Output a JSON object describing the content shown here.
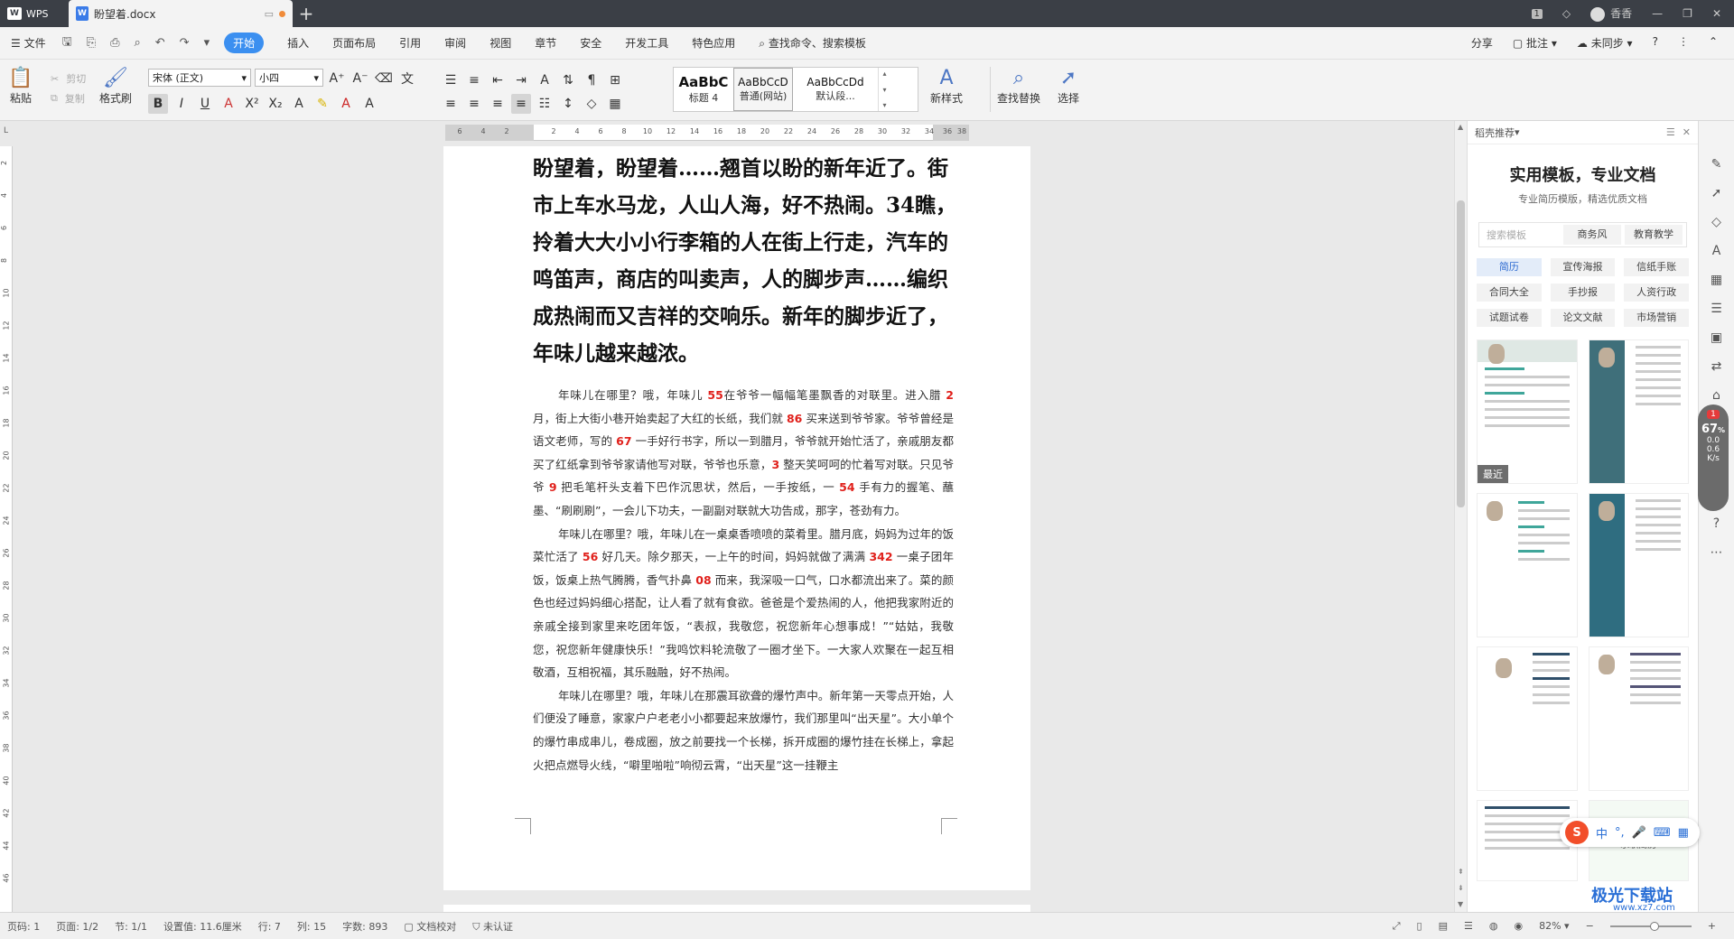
{
  "titlebar": {
    "app": "WPS",
    "doc_tab": "盼望着.docx",
    "user": "香香"
  },
  "menu": {
    "file": "文件",
    "items": [
      "开始",
      "插入",
      "页面布局",
      "引用",
      "审阅",
      "视图",
      "章节",
      "安全",
      "开发工具",
      "特色应用"
    ],
    "active": "开始",
    "search": "查找命令、搜索模板",
    "share": "分享",
    "comment": "批注",
    "sync": "未同步"
  },
  "ribbon": {
    "paste": "粘贴",
    "cut": "剪切",
    "copy": "复制",
    "format_painter": "格式刷",
    "font_name": "宋体 (正文)",
    "font_size": "小四",
    "styles": [
      {
        "preview": "AaBbC",
        "name": "标题 4"
      },
      {
        "preview": "AaBbCcD",
        "name": "普通(网站)"
      },
      {
        "preview": "AaBbCcDd",
        "name": "默认段..."
      }
    ],
    "new_style": "新样式",
    "find_replace": "查找替换",
    "select": "选择"
  },
  "ruler": {
    "h_ticks": [
      "6",
      "4",
      "2",
      "",
      "2",
      "4",
      "6",
      "8",
      "10",
      "12",
      "14",
      "16",
      "18",
      "20",
      "22",
      "24",
      "26",
      "28",
      "30",
      "32",
      "34",
      "36",
      "38",
      "40"
    ],
    "v_ticks": [
      "2",
      "4",
      "6",
      "8",
      "10",
      "12",
      "14",
      "16",
      "18",
      "20",
      "22",
      "24",
      "26",
      "28",
      "30",
      "32",
      "34",
      "36",
      "38",
      "40",
      "42",
      "44",
      "46"
    ]
  },
  "document": {
    "heading": "盼望着，盼望着……翘首以盼的新年近了。街市上车水马龙，人山人海，好不热闹。34瞧，拎着大大小小行李箱的人在街上行走，汽车的鸣笛声，商店的叫卖声，人的脚步声……编织成热闹而又吉祥的交响乐。新年的脚步近了，年味儿越来越浓。",
    "paragraphs": [
      [
        {
          "t": "年味儿在哪里？哦，年味儿 "
        },
        {
          "t": "55",
          "r": true
        },
        {
          "t": "在爷爷一幅幅笔墨飘香的对联里。进入腊 "
        },
        {
          "t": "2",
          "r": true
        },
        {
          "t": " 月，街上大街小巷开始卖起了大红的长纸，我们就 "
        },
        {
          "t": "86",
          "r": true
        },
        {
          "t": " 买来送到爷爷家。爷爷曾经是语文老师，写的 "
        },
        {
          "t": "67",
          "r": true
        },
        {
          "t": " 一手好行书字，所以一到腊月，爷爷就开始忙活了，亲戚朋友都买了红纸拿到爷爷家请他写对联，爷爷也乐意，"
        },
        {
          "t": "3",
          "r": true
        },
        {
          "t": " 整天笑呵呵的忙着写对联。只见爷爷 "
        },
        {
          "t": "9",
          "r": true
        },
        {
          "t": " 把毛笔杆头支着下巴作沉思状，然后，一手按纸，一 "
        },
        {
          "t": "54",
          "r": true
        },
        {
          "t": " 手有力的握笔、蘸墨、“刷刷刷”，一会儿下功夫，一副副对联就大功告成，那字，苍劲有力。"
        }
      ],
      [
        {
          "t": "年味儿在哪里？哦，年味儿在一桌桌香喷喷的菜肴里。腊月底，妈妈为过年的饭菜忙活了 "
        },
        {
          "t": "56",
          "r": true
        },
        {
          "t": " 好几天。除夕那天，一上午的时间，妈妈就做了满满 "
        },
        {
          "t": "342",
          "r": true
        },
        {
          "t": " 一桌子团年饭，饭桌上热气腾腾，香气扑鼻 "
        },
        {
          "t": "08",
          "r": true
        },
        {
          "t": " 而来，我深吸一口气，口水都流出来了。菜的颜色也经过妈妈细心搭配，让人看了就有食欲。爸爸是个爱热闹的人，他把我家附近的亲戚全接到家里来吃团年饭，“表叔，我敬您，祝您新年心想事成！”“姑姑，我敬您，祝您新年健康快乐！”我鸣饮料轮流敬了一圈才坐下。一大家人欢聚在一起互相敬酒，互相祝福，其乐融融，好不热闹。"
        }
      ],
      [
        {
          "t": "年味儿在哪里？哦，年味儿在那震耳欲聋的爆竹声中。新年第一天零点开始，人们便没了睡意，家家户户老老小小都要起来放爆竹，我们那里叫“出天星”。大小单个的爆竹串成串儿，卷成圈，放之前要找一个长梯，拆开成圈的爆竹挂在长梯上，拿起火把点燃导火线，“噼里啪啦”响彻云霄，“出天星”这一挂鞭主"
        }
      ]
    ]
  },
  "panel": {
    "header": "稻壳推荐",
    "title": "实用模板，专业文档",
    "subtitle": "专业简历模版，精选优质文档",
    "search_placeholder": "搜索模板",
    "tags": [
      "商务风",
      "教育教学"
    ],
    "categories": [
      "简历",
      "宣传海报",
      "信纸手账",
      "合同大全",
      "手抄报",
      "人资行政",
      "试题试卷",
      "论文文献",
      "市场营销"
    ],
    "active_category": "简历",
    "recent": "最近",
    "last_card_text": "求职简历"
  },
  "speed_widget": {
    "badge": "1",
    "value": "67",
    "unit": "%",
    "up": "0.0",
    "down": "0.6",
    "rate_unit": "K/s"
  },
  "ime": {
    "lang": "中",
    "logo": "S"
  },
  "statusbar": {
    "page_code": "页码: 1",
    "page": "页面: 1/2",
    "section": "节: 1/1",
    "setting": "设置值: 11.6厘米",
    "row": "行: 7",
    "col": "列: 15",
    "words": "字数: 893",
    "proof": "文档校对",
    "cert": "未认证",
    "zoom": "82%",
    "zoom_fraction": 0.55
  },
  "watermark": {
    "text": "极光下载站",
    "url": "www.xz7.com"
  }
}
